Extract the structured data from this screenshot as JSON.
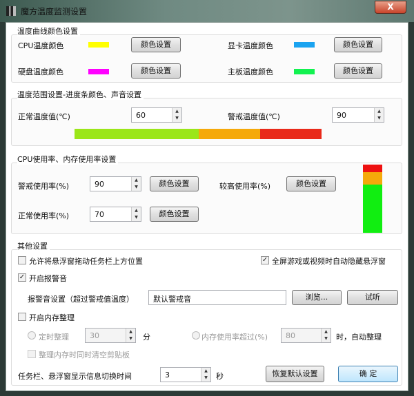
{
  "window": {
    "title": "魔方温度监测设置",
    "close": "X"
  },
  "curve_colors": {
    "title": "温度曲线颜色设置",
    "cpu_label": "CPU温度颜色",
    "cpu_color": "#ffff00",
    "gpu_label": "显卡温度颜色",
    "gpu_color": "#1aa3f0",
    "disk_label": "硬盘温度颜色",
    "disk_color": "#ff00ff",
    "board_label": "主板温度颜色",
    "board_color": "#12f250",
    "button": "颜色设置"
  },
  "temp_range": {
    "title": "温度范围设置-进度条颜色、声音设置",
    "normal_label": "正常温度值(℃)",
    "normal_value": "60",
    "warn_label": "警戒温度值(℃)",
    "warn_value": "90",
    "bar_colors": [
      "#9be619",
      "#f5a90a",
      "#e92a1a"
    ]
  },
  "usage": {
    "title": "CPU使用率、内存使用率设置",
    "warn_label": "警戒使用率(%)",
    "warn_value": "90",
    "high_label": "较高使用率(%)",
    "normal_label": "正常使用率(%)",
    "normal_value": "70",
    "button": "颜色设置",
    "bar_colors": [
      "#ee1111",
      "#f5a90a",
      "#11ee11"
    ]
  },
  "other": {
    "title": "其他设置",
    "allow_drag": "允许将悬浮窗拖动任务栏上方位置",
    "allow_drag_checked": false,
    "fullscreen_hide": "全屏游戏或视频时自动隐藏悬浮窗",
    "fullscreen_hide_checked": true,
    "alarm_enable": "开启报警音",
    "alarm_enable_checked": true,
    "alarm_label": "报警音设置（超过警戒值温度）",
    "alarm_value": "默认警戒音",
    "browse": "浏览...",
    "listen": "试听",
    "mem_enable": "开启内存整理",
    "mem_enable_checked": false,
    "timed_label": "定时整理",
    "timed_value": "30",
    "minute": "分",
    "usage_over_label": "内存使用率超过(%)",
    "usage_over_value": "80",
    "auto_clean": "时，自动整理",
    "clear_clipboard": "整理内存时同时清空剪贴板",
    "switch_label": "任务栏、悬浮窗显示信息切换时间",
    "switch_value": "3",
    "second": "秒",
    "restore": "恢复默认设置",
    "ok": "确 定"
  }
}
